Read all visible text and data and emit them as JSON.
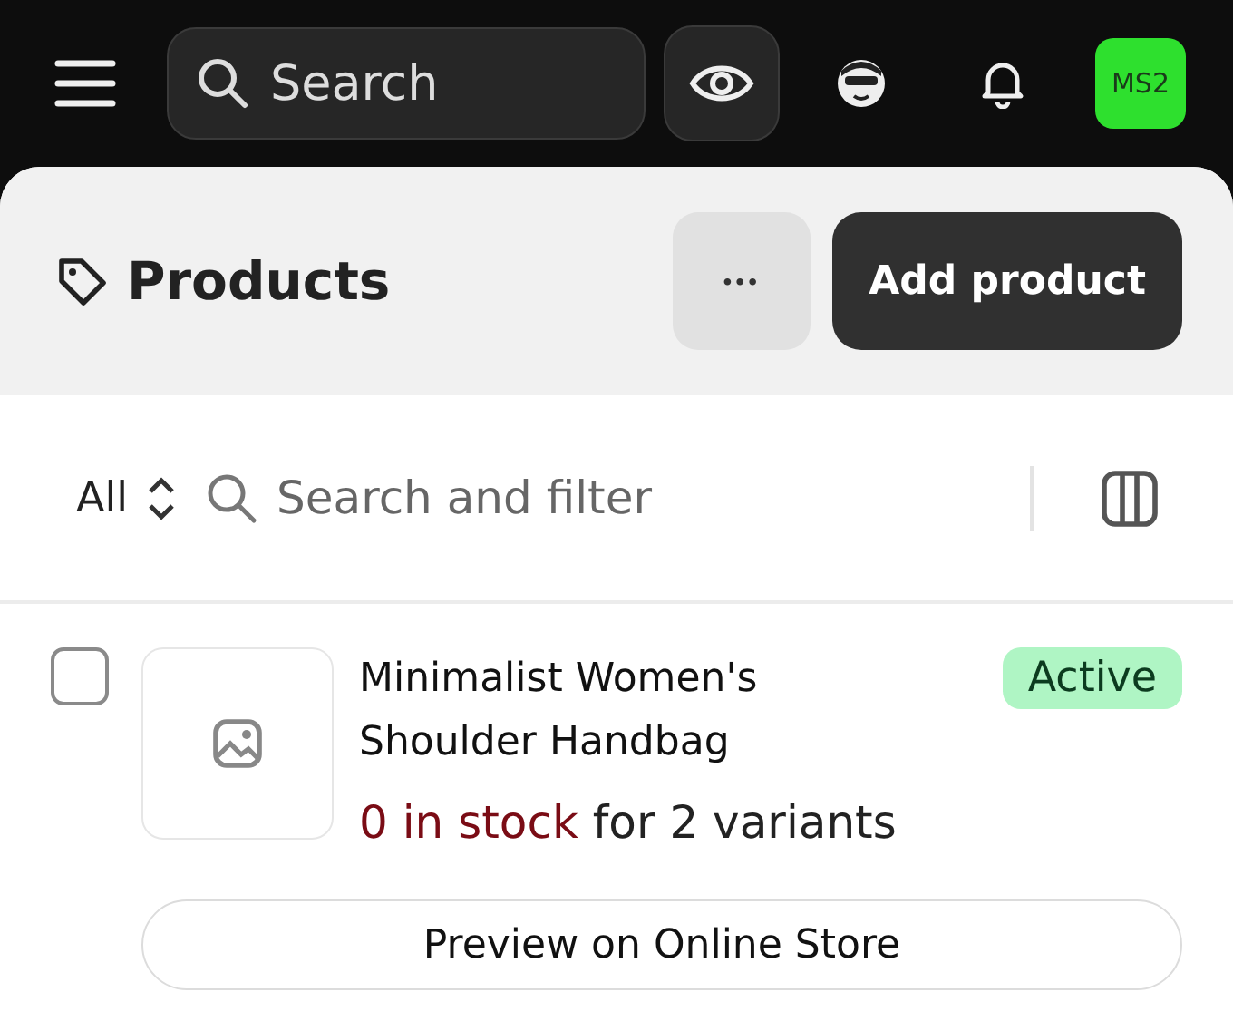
{
  "topbar": {
    "search": {
      "placeholder": "Search"
    },
    "avatar": "MS2"
  },
  "header": {
    "title": "Products",
    "more_label": "•••",
    "primary_button": "Add product"
  },
  "filter": {
    "view": "All",
    "search": {
      "placeholder": "Search and filter"
    }
  },
  "products": [
    {
      "checked": false,
      "name": "Minimalist Women's Shoulder Handbag",
      "status": "Active",
      "stock_warning": "0 in stock",
      "stock_rest": " for 2 variants",
      "preview_button": "Preview on Online Store"
    }
  ]
}
